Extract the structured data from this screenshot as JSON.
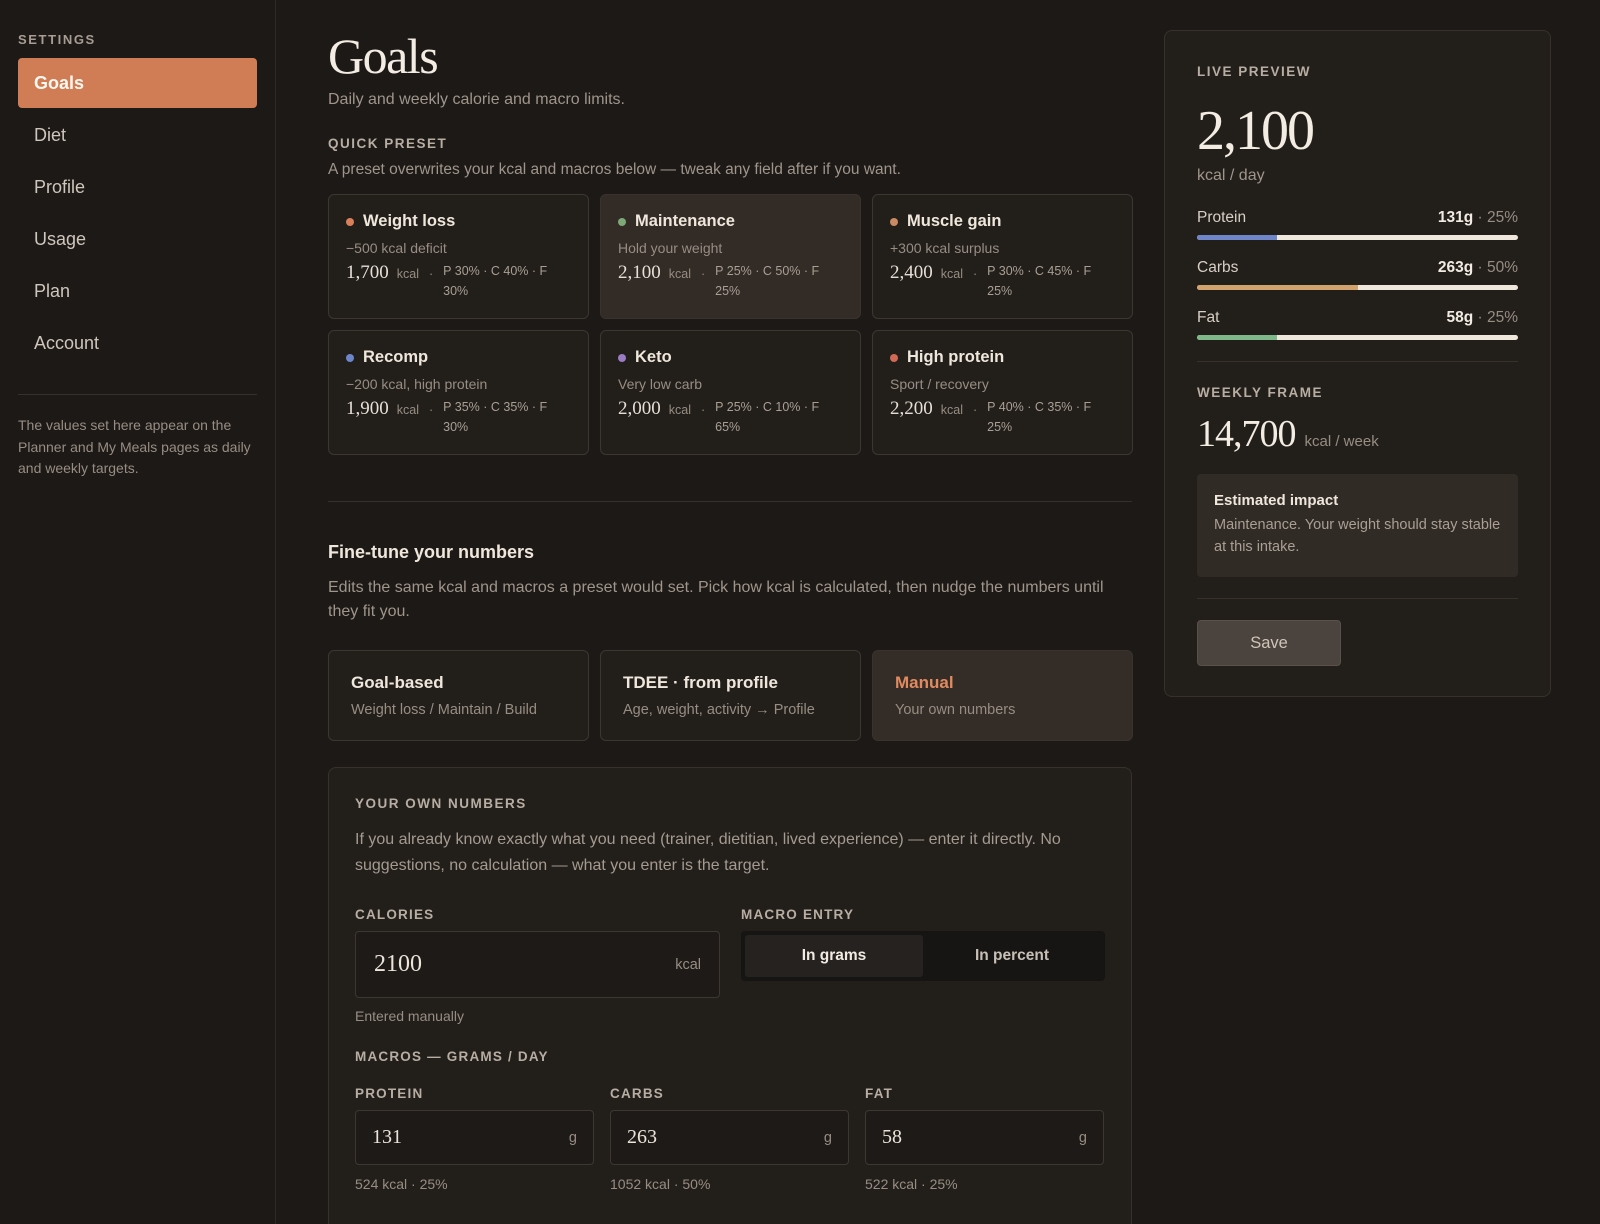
{
  "sidebar": {
    "heading": "SETTINGS",
    "items": [
      {
        "label": "Goals",
        "active": true
      },
      {
        "label": "Diet"
      },
      {
        "label": "Profile"
      },
      {
        "label": "Usage"
      },
      {
        "label": "Plan"
      },
      {
        "label": "Account"
      }
    ],
    "note": "The values set here appear on the Planner and My Meals pages as daily and weekly targets."
  },
  "header": {
    "title": "Goals",
    "subtitle": "Daily and weekly calorie and macro limits."
  },
  "quick_preset": {
    "label": "QUICK PRESET",
    "description": "A preset overwrites your kcal and macros below — tweak any field after if you want.",
    "kcal_unit": "kcal",
    "separator": "·",
    "presets": [
      {
        "name": "Weight loss",
        "sub": "−500 kcal deficit",
        "kcal": "1,700",
        "macros": "P 30% · C 40% · F 30%",
        "dot_color": "#d9805a",
        "selected": false
      },
      {
        "name": "Maintenance",
        "sub": "Hold your weight",
        "kcal": "2,100",
        "macros": "P 25% · C 50% · F 25%",
        "dot_color": "#7fa878",
        "selected": true
      },
      {
        "name": "Muscle gain",
        "sub": "+300 kcal surplus",
        "kcal": "2,400",
        "macros": "P 30% · C 45% · F 25%",
        "dot_color": "#c98a64",
        "selected": false
      },
      {
        "name": "Recomp",
        "sub": "−200 kcal, high protein",
        "kcal": "1,900",
        "macros": "P 35% · C 35% · F 30%",
        "dot_color": "#6f85c9",
        "selected": false
      },
      {
        "name": "Keto",
        "sub": "Very low carb",
        "kcal": "2,000",
        "macros": "P 25% · C 10% · F 65%",
        "dot_color": "#9a7bc4",
        "selected": false
      },
      {
        "name": "High protein",
        "sub": "Sport / recovery",
        "kcal": "2,200",
        "macros": "P 40% · C 35% · F 25%",
        "dot_color": "#d06a55",
        "selected": false
      }
    ]
  },
  "finetune": {
    "title": "Fine-tune your numbers",
    "description": "Edits the same kcal and macros a preset would set. Pick how kcal is calculated, then nudge the numbers until they fit you.",
    "modes": [
      {
        "title": "Goal-based",
        "sub": "Weight loss / Maintain / Build",
        "selected": false
      },
      {
        "title": "TDEE · from profile",
        "sub": "Age, weight, activity → Profile",
        "selected": false
      },
      {
        "title": "Manual",
        "sub": "Your own numbers",
        "selected": true
      }
    ]
  },
  "own_numbers": {
    "label": "YOUR OWN NUMBERS",
    "description": "If you already know exactly what you need (trainer, dietitian, lived experience) — enter it directly. No suggestions, no calculation — what you enter is the target.",
    "calories": {
      "label": "CALORIES",
      "value": "2100",
      "unit": "kcal",
      "hint": "Entered manually"
    },
    "macro_entry": {
      "label": "MACRO ENTRY",
      "options": [
        "In grams",
        "In percent"
      ],
      "selected": "In grams"
    },
    "macros_label": "MACROS — GRAMS / DAY",
    "macros": [
      {
        "label": "PROTEIN",
        "value": "131",
        "unit": "g",
        "hint": "524 kcal · 25%"
      },
      {
        "label": "CARBS",
        "value": "263",
        "unit": "g",
        "hint": "1052 kcal · 50%"
      },
      {
        "label": "FAT",
        "value": "58",
        "unit": "g",
        "hint": "522 kcal · 25%"
      }
    ]
  },
  "preview": {
    "label": "LIVE PREVIEW",
    "kcal": "2,100",
    "unit": "kcal / day",
    "macros": [
      {
        "name": "Protein",
        "grams": "131g",
        "pct_text": "· 25%",
        "fill": 0.25,
        "color": "#6f85c9"
      },
      {
        "name": "Carbs",
        "grams": "263g",
        "pct_text": "· 50%",
        "fill": 0.5,
        "color": "#d2a26e"
      },
      {
        "name": "Fat",
        "grams": "58g",
        "pct_text": "· 25%",
        "fill": 0.25,
        "color": "#7fb888"
      }
    ],
    "weekly_label": "WEEKLY FRAME",
    "weekly_value": "14,700",
    "weekly_unit": "kcal / week",
    "impact_title": "Estimated impact",
    "impact_text": "Maintenance. Your weight should stay stable at this intake.",
    "save_label": "Save"
  }
}
